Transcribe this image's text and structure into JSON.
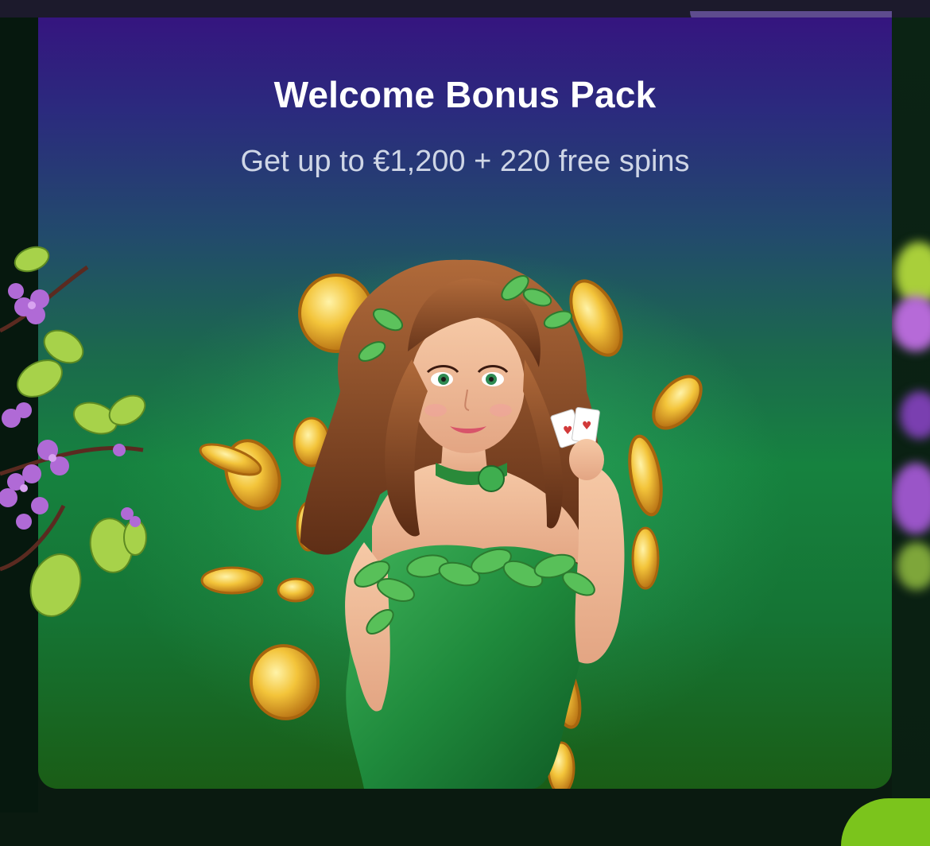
{
  "promo": {
    "title": "Welcome Bonus Pack",
    "subtitle": "Get up to €1,200 + 220 free spins"
  },
  "colors": {
    "accent_green": "#7bc41c",
    "card_top": "#35157f",
    "card_bottom": "#1a5d16"
  },
  "hero_image": {
    "icon": "lady-with-cards-and-gold-coins-illustration"
  }
}
